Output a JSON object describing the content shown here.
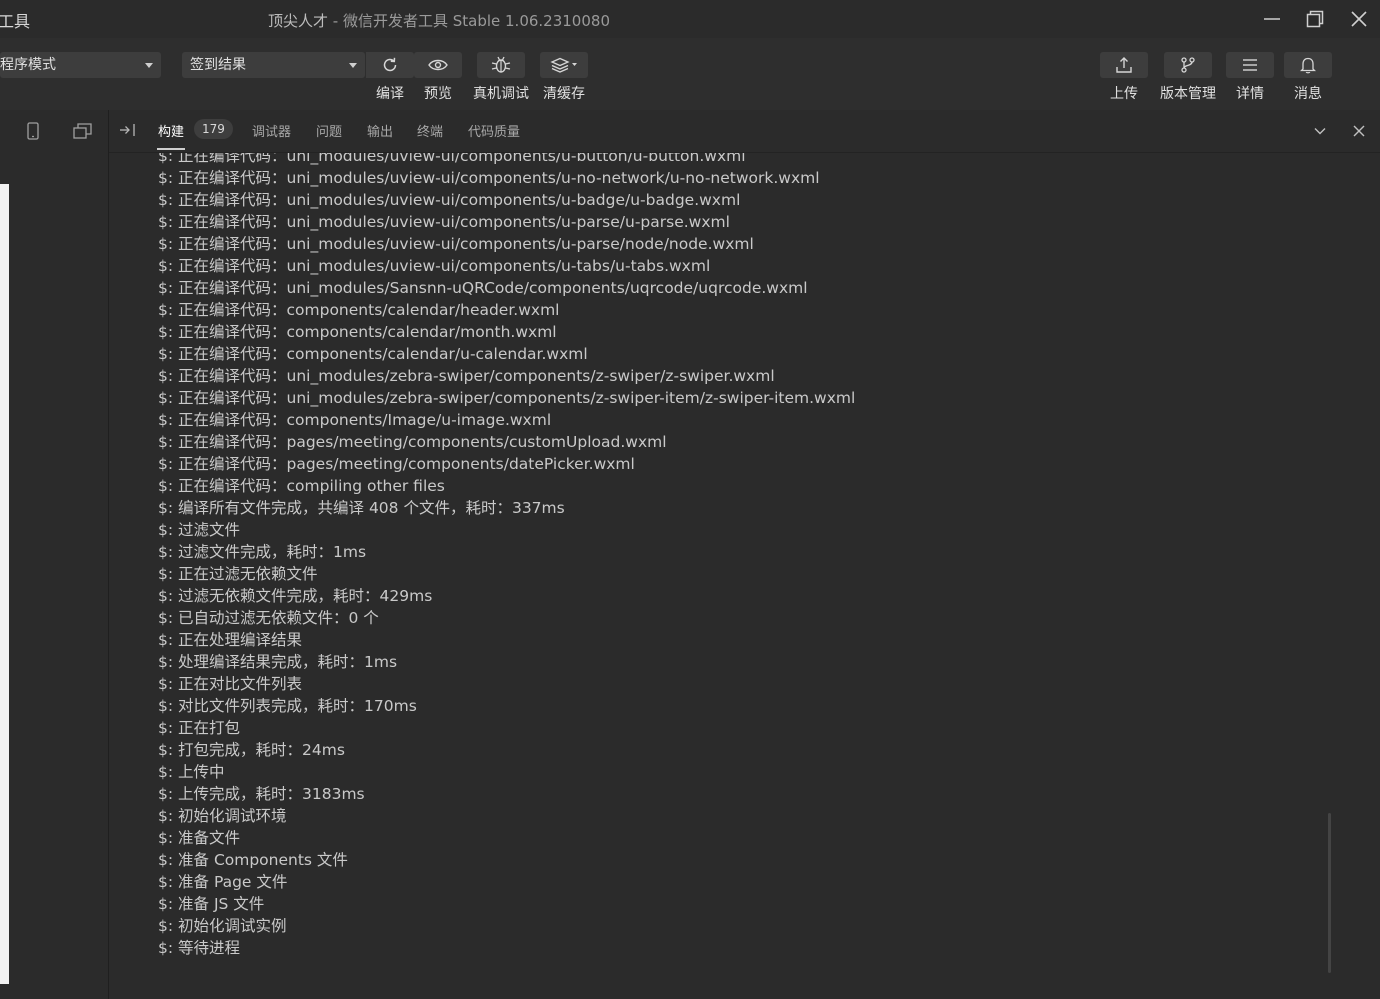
{
  "window": {
    "app_name": "工具",
    "project_name": "顶尖人才",
    "title_suffix": " - 微信开发者工具 Stable 1.06.2310080"
  },
  "toolbar": {
    "mode_select": "程序模式",
    "compile_select": "签到结果",
    "left_tools": [
      {
        "label": "编译",
        "icon": "refresh-icon"
      },
      {
        "label": "预览",
        "icon": "eye-icon"
      },
      {
        "label": "真机调试",
        "icon": "bug-icon"
      },
      {
        "label": "清缓存",
        "icon": "layers-icon"
      }
    ],
    "right_tools": [
      {
        "label": "上传",
        "icon": "upload-icon"
      },
      {
        "label": "版本管理",
        "icon": "branch-icon"
      },
      {
        "label": "详情",
        "icon": "menu-icon"
      },
      {
        "label": "消息",
        "icon": "bell-icon"
      }
    ]
  },
  "panel": {
    "tabs": [
      "构建",
      "调试器",
      "问题",
      "输出",
      "终端",
      "代码质量"
    ],
    "active_tab": "构建",
    "build_count": "179"
  },
  "console_lines": [
    "$: 正在编译代码：uni_modules/uview-ui/components/u-button/u-button.wxml",
    "$: 正在编译代码：uni_modules/uview-ui/components/u-no-network/u-no-network.wxml",
    "$: 正在编译代码：uni_modules/uview-ui/components/u-badge/u-badge.wxml",
    "$: 正在编译代码：uni_modules/uview-ui/components/u-parse/u-parse.wxml",
    "$: 正在编译代码：uni_modules/uview-ui/components/u-parse/node/node.wxml",
    "$: 正在编译代码：uni_modules/uview-ui/components/u-tabs/u-tabs.wxml",
    "$: 正在编译代码：uni_modules/Sansnn-uQRCode/components/uqrcode/uqrcode.wxml",
    "$: 正在编译代码：components/calendar/header.wxml",
    "$: 正在编译代码：components/calendar/month.wxml",
    "$: 正在编译代码：components/calendar/u-calendar.wxml",
    "$: 正在编译代码：uni_modules/zebra-swiper/components/z-swiper/z-swiper.wxml",
    "$: 正在编译代码：uni_modules/zebra-swiper/components/z-swiper-item/z-swiper-item.wxml",
    "$: 正在编译代码：components/Image/u-image.wxml",
    "$: 正在编译代码：pages/meeting/components/customUpload.wxml",
    "$: 正在编译代码：pages/meeting/components/datePicker.wxml",
    "$: 正在编译代码：compiling other files",
    "$: 编译所有文件完成，共编译 408 个文件，耗时：337ms",
    "$: 过滤文件",
    "$: 过滤文件完成，耗时：1ms",
    "$: 正在过滤无依赖文件",
    "$: 过滤无依赖文件完成，耗时：429ms",
    "$: 已自动过滤无依赖文件：0 个",
    "$: 正在处理编译结果",
    "$: 处理编译结果完成，耗时：1ms",
    "$: 正在对比文件列表",
    "$: 对比文件列表完成，耗时：170ms",
    "$: 正在打包",
    "$: 打包完成，耗时：24ms",
    "$: 上传中",
    "$: 上传完成，耗时：3183ms",
    "$: 初始化调试环境",
    "$: 准备文件",
    "$: 准备 Components 文件",
    "$: 准备 Page 文件",
    "$: 准备 JS 文件",
    "$: 初始化调试实例",
    "$: 等待进程"
  ]
}
